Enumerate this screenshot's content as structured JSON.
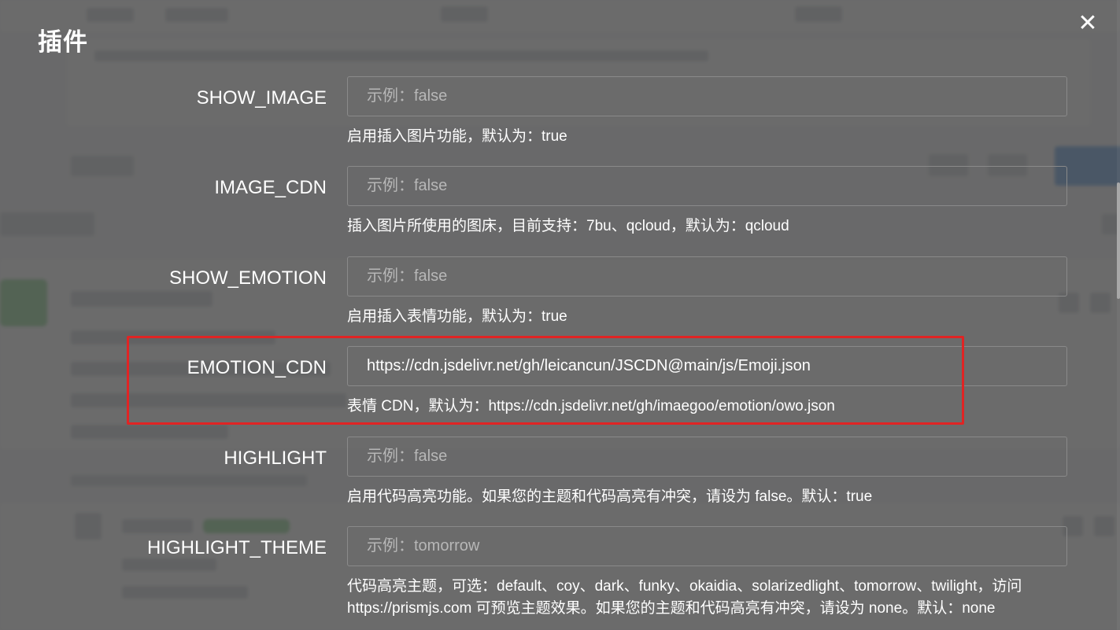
{
  "dialog": {
    "title": "插件",
    "close_symbol": "✕"
  },
  "fields": [
    {
      "key": "SHOW_IMAGE",
      "value": "",
      "placeholder": "示例：false",
      "help": "启用插入图片功能，默认为：true"
    },
    {
      "key": "IMAGE_CDN",
      "value": "",
      "placeholder": "示例：false",
      "help": "插入图片所使用的图床，目前支持：7bu、qcloud，默认为：qcloud"
    },
    {
      "key": "SHOW_EMOTION",
      "value": "",
      "placeholder": "示例：false",
      "help": "启用插入表情功能，默认为：true"
    },
    {
      "key": "EMOTION_CDN",
      "value": "https://cdn.jsdelivr.net/gh/leicancun/JSCDN@main/js/Emoji.json",
      "placeholder": "",
      "help": "表情 CDN，默认为：https://cdn.jsdelivr.net/gh/imaegoo/emotion/owo.json"
    },
    {
      "key": "HIGHLIGHT",
      "value": "",
      "placeholder": "示例：false",
      "help": "启用代码高亮功能。如果您的主题和代码高亮有冲突，请设为 false。默认：true"
    },
    {
      "key": "HIGHLIGHT_THEME",
      "value": "",
      "placeholder": "示例：tomorrow",
      "help": "代码高亮主题，可选：default、coy、dark、funky、okaidia、solarizedlight、tomorrow、twilight，访问 https://prismjs.com 可预览主题效果。如果您的主题和代码高亮有冲突，请设为 none。默认：none"
    }
  ],
  "colors": {
    "overlay": "#4b4b4b",
    "highlight_border": "#e02424",
    "text": "#ffffff"
  }
}
